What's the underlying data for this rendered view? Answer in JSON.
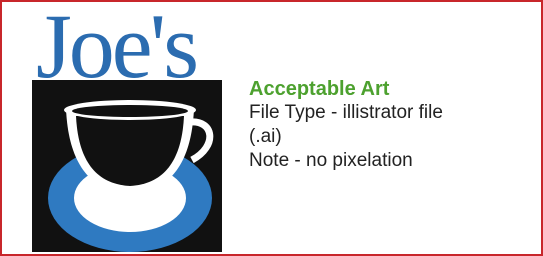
{
  "logo": {
    "text": "Joe's",
    "icon": "coffee-cup-icon",
    "colors": {
      "text_blue": "#2b6cb0",
      "cup_blue": "#2f7ac1",
      "background_black": "#111111"
    }
  },
  "info": {
    "heading": "Acceptable Art",
    "file_type": "File Type - illistrator file",
    "extension": "(.ai)",
    "note": "Note - no pixelation"
  },
  "colors": {
    "border": "#c8262b",
    "heading": "#4da12f",
    "body_text": "#222222"
  }
}
